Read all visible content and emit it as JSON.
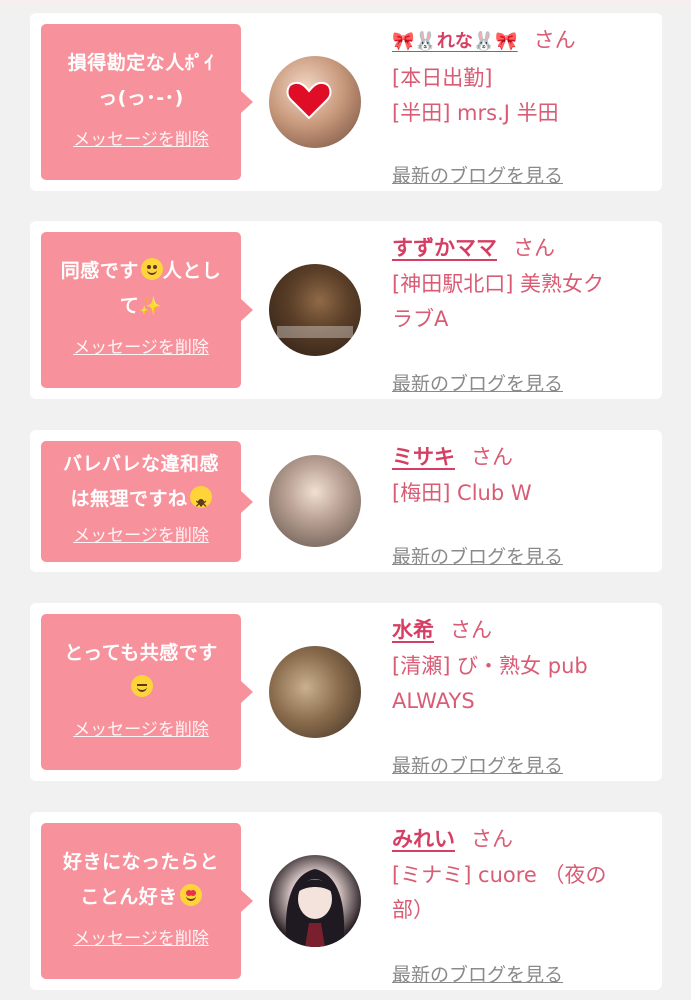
{
  "entries": [
    {
      "message_line1": "損得勘定な人ﾎﾟｲ",
      "message_line2": "っ(っ･-･)",
      "message_emoji": "",
      "delete_label": "メッセージを削除",
      "avatar": "avatar-heart-sticker",
      "name": "🎀🐰れな🐰🎀",
      "honorific": "さん",
      "shop_line1": "[本日出勤]",
      "shop_line2": "[半田] mrs.J 半田",
      "blog_link": "最新のブログを見る"
    },
    {
      "message_line1": "同感です😊人とし",
      "message_line2": "て✨",
      "message_emoji": "smile",
      "delete_label": "メッセージを削除",
      "avatar": "avatar-photo",
      "name": "すずかママ",
      "honorific": "さん",
      "shop_line1": "[神田駅北口] 美熟女ク",
      "shop_line2": "ラブA",
      "blog_link": "最新のブログを見る"
    },
    {
      "message_line1": "バレバレな違和感",
      "message_line2": "は無理ですね😵",
      "message_emoji": "dizzy",
      "delete_label": "メッセージを削除",
      "avatar": "avatar-photo",
      "name": "ミサキ",
      "honorific": "さん",
      "shop_line1": "[梅田] Club W",
      "shop_line2": "",
      "blog_link": "最新のブログを見る"
    },
    {
      "message_line1": "とっても共感です",
      "message_line2": "😌",
      "message_emoji": "relief",
      "delete_label": "メッセージを削除",
      "avatar": "avatar-photo",
      "name": "水希",
      "honorific": "さん",
      "shop_line1": "[清瀬] び・熟女 pub",
      "shop_line2": "ALWAYS",
      "blog_link": "最新のブログを見る"
    },
    {
      "message_line1": "好きになったらと",
      "message_line2": "ことん好き😍",
      "message_emoji": "heart-eyes",
      "delete_label": "メッセージを削除",
      "avatar": "avatar-anime-illustration",
      "name": "みれい",
      "honorific": "さん",
      "shop_line1": "[ミナミ] cuore （夜の",
      "shop_line2": "部）",
      "blog_link": "最新のブログを見る"
    }
  ],
  "colors": {
    "bubble": "#f7929c",
    "name": "#d43f63",
    "text": "#d95b74",
    "link": "#8a8a8a",
    "background": "#f1f1f1"
  }
}
